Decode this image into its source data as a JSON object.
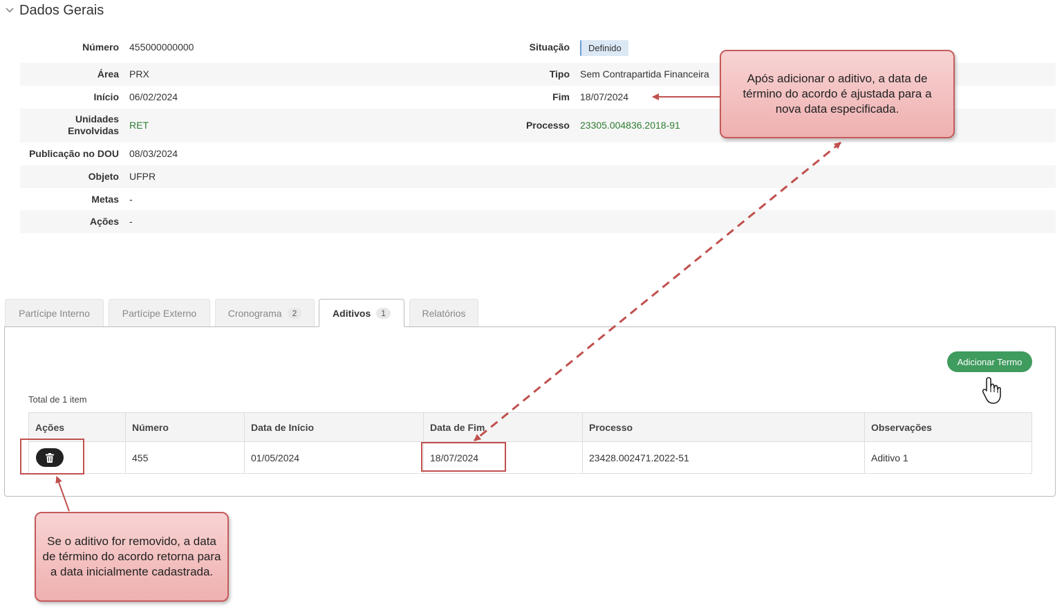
{
  "section": {
    "title": "Dados Gerais"
  },
  "general": {
    "numero": {
      "label": "Número",
      "value": "455000000000"
    },
    "situacao": {
      "label": "Situação",
      "value": "Definido"
    },
    "area": {
      "label": "Área",
      "value": "PRX"
    },
    "tipo": {
      "label": "Tipo",
      "value": "Sem Contrapartida Financeira"
    },
    "inicio": {
      "label": "Início",
      "value": "06/02/2024"
    },
    "fim": {
      "label": "Fim",
      "value": "18/07/2024"
    },
    "unidades": {
      "label_line1": "Unidades",
      "label_line2": "Envolvidas",
      "value": "RET"
    },
    "processo": {
      "label": "Processo",
      "value": "23305.004836.2018-91"
    },
    "publicacao": {
      "label": "Publicação no DOU",
      "value": "08/03/2024"
    },
    "objeto": {
      "label": "Objeto",
      "value": "UFPR"
    },
    "metas": {
      "label": "Metas",
      "value": "-"
    },
    "acoes": {
      "label": "Ações",
      "value": "-"
    }
  },
  "tabs": [
    {
      "label": "Partícipe Interno"
    },
    {
      "label": "Partícipe Externo"
    },
    {
      "label": "Cronograma",
      "count": "2"
    },
    {
      "label": "Aditivos",
      "count": "1",
      "active": true
    },
    {
      "label": "Relatórios"
    }
  ],
  "aditivos": {
    "add_button": "Adicionar Termo",
    "total_text": "Total de 1 item",
    "columns": [
      "Ações",
      "Número",
      "Data de Início",
      "Data de Fim",
      "Processo",
      "Observações"
    ],
    "rows": [
      {
        "numero": "455",
        "data_inicio": "01/05/2024",
        "data_fim": "18/07/2024",
        "processo": "23428.002471.2022-51",
        "observacoes": "Aditivo 1"
      }
    ]
  },
  "callouts": {
    "top": "Após adicionar o aditivo, a data de término do acordo é ajustada para a nova data especificada.",
    "bottom": "Se o aditivo for removido, a data de término do acordo retorna para a data inicialmente cadastrada."
  },
  "colors": {
    "link": "#2e7d32",
    "button": "#3f9b5e",
    "annotation": "#c0504d"
  },
  "icons": [
    "chevron-down-icon",
    "trash-icon",
    "hand-pointer-icon"
  ]
}
